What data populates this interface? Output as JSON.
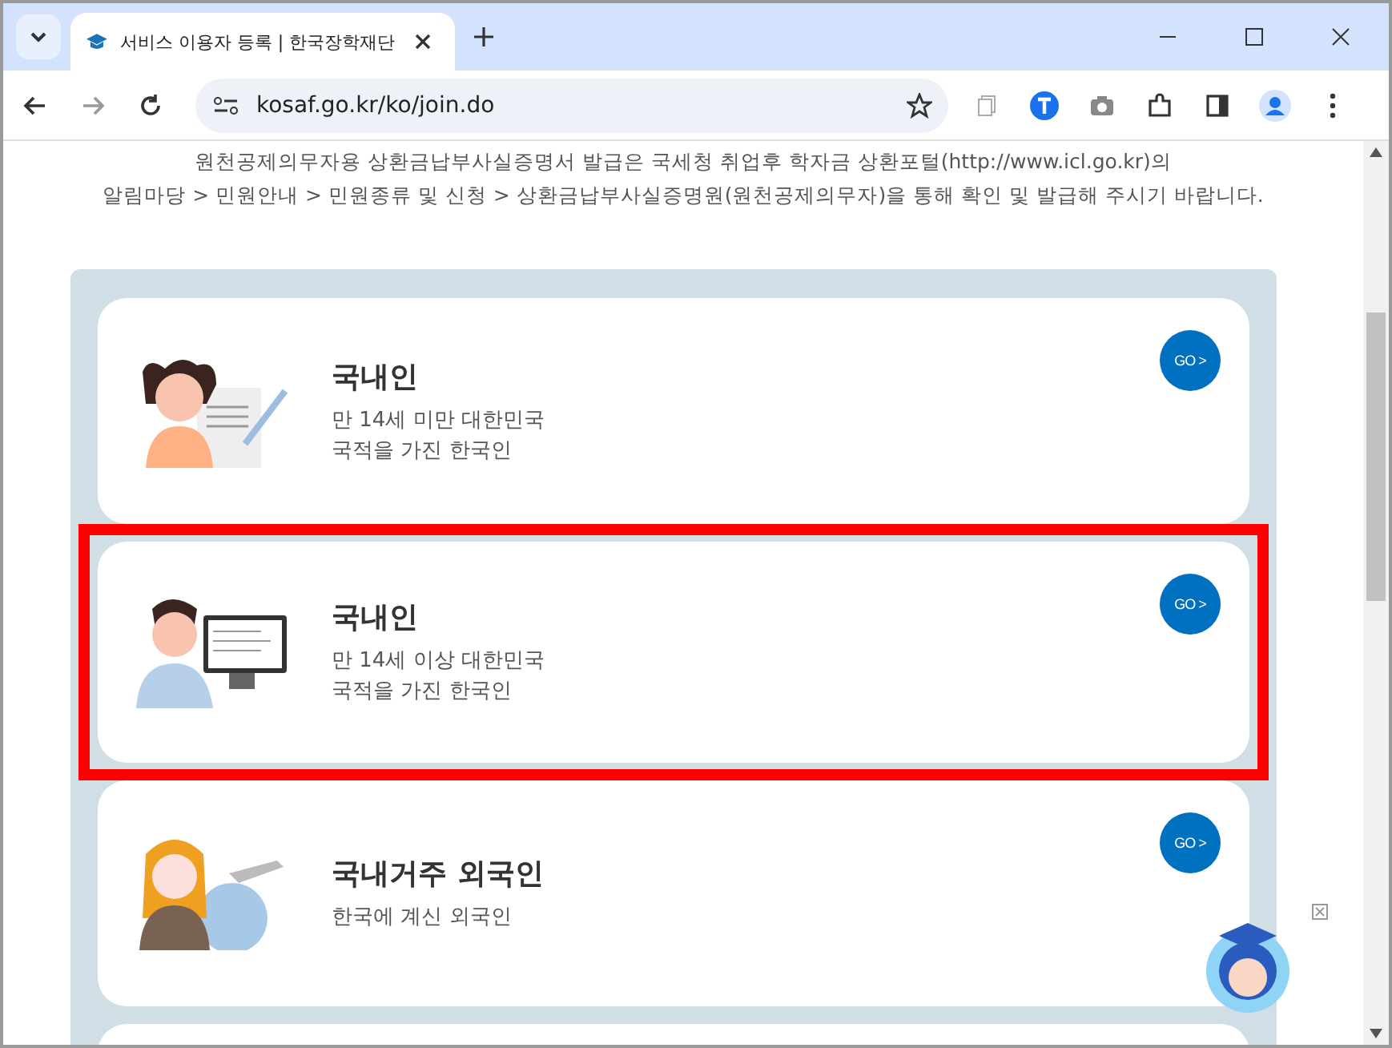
{
  "browser": {
    "tab_title": "서비스 이용자 등록 | 한국장학재단",
    "url": "kosaf.go.kr/ko/join.do"
  },
  "notice": [
    "원천공제의무자용 상환금납부사실증명서 발급은 국세청 취업후 학자금 상환포털(http://www.icl.go.kr)의",
    "알림마당 > 민원안내 > 민원종류 및 신청 > 상환금납부사실증명원(원천공제의무자)을 통해 확인 및 발급해 주시기 바랍니다."
  ],
  "cards": [
    {
      "kind": "child",
      "title": "국내인",
      "lines": [
        "만 14세 미만 대한민국",
        "국적을 가진 한국인"
      ],
      "button": "GO >",
      "highlighted": false
    },
    {
      "kind": "adult",
      "title": "국내인",
      "lines": [
        "만 14세 이상 대한민국",
        "국적을 가진 한국인"
      ],
      "button": "GO >",
      "highlighted": true
    },
    {
      "kind": "foreigner",
      "title": "국내거주 외국인",
      "lines": [
        "한국에 계신 외국인"
      ],
      "button": "GO >",
      "highlighted": false
    }
  ]
}
